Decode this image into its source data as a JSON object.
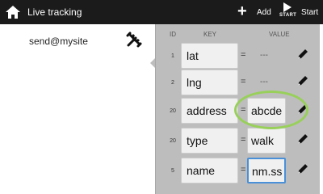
{
  "header": {
    "title": "Live tracking",
    "add_label": "Add",
    "start_small": "START",
    "start_label": "Start"
  },
  "contacts": [
    {
      "label": "send@mysite"
    }
  ],
  "table": {
    "col_id": "ID",
    "col_key": "KEY",
    "col_value": "VALUE",
    "rows": [
      {
        "id": "1",
        "key": "lat",
        "eq": "=",
        "value": "---",
        "value_style": "plain"
      },
      {
        "id": "2",
        "key": "lng",
        "eq": "=",
        "value": "---",
        "value_style": "plain"
      },
      {
        "id": "20",
        "key": "address",
        "eq": "=",
        "value": "abcde",
        "value_style": "filled"
      },
      {
        "id": "20",
        "key": "type",
        "eq": "=",
        "value": "walk",
        "value_style": "filled"
      },
      {
        "id": "5",
        "key": "name",
        "eq": "=",
        "value": "nm.ss",
        "value_style": "active"
      }
    ]
  },
  "colors": {
    "topbar": "#1b1b1b",
    "panel": "#bdbdbd",
    "focus_border": "#4a90d9",
    "annotation_ring": "#98d05a"
  },
  "icons": {
    "home": "home-icon",
    "add": "plus-icon",
    "start": "play-icon",
    "tools": "tools-icon",
    "edit": "pencil-icon"
  }
}
